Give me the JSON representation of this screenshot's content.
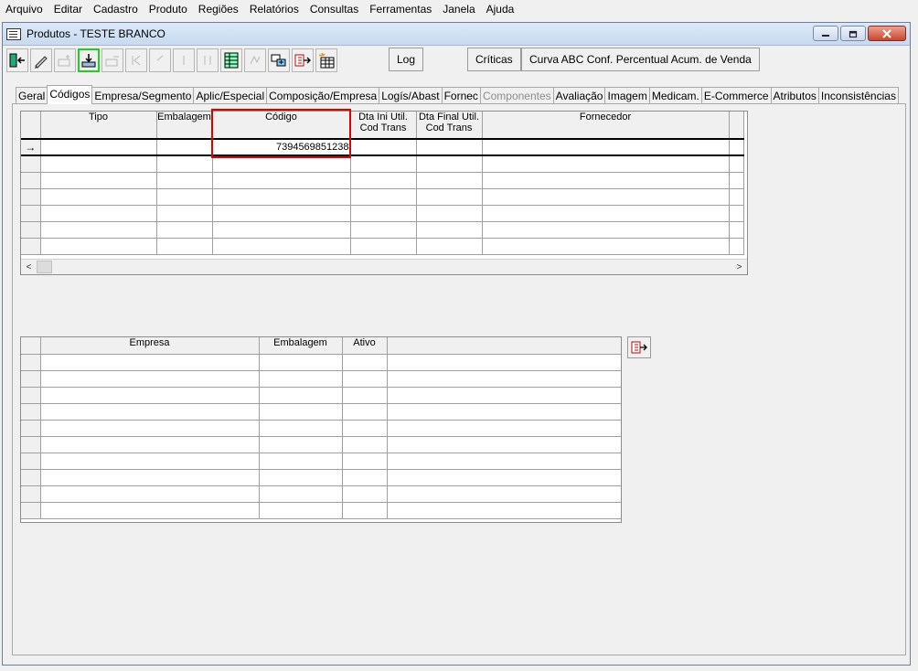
{
  "menu": [
    "Arquivo",
    "Editar",
    "Cadastro",
    "Produto",
    "Regiões",
    "Relatórios",
    "Consultas",
    "Ferramentas",
    "Janela",
    "Ajuda"
  ],
  "window": {
    "title": "Produtos - TESTE BRANCO"
  },
  "toolbar": {
    "log_label": "Log",
    "criticas_label": "Críticas",
    "curva_label": "Curva ABC Conf. Percentual Acum. de Venda"
  },
  "tabs": [
    "Geral",
    "Códigos",
    "Empresa/Segmento",
    "Aplic/Especial",
    "Composição/Empresa",
    "Logís/Abast",
    "Fornec",
    "Componentes",
    "Avaliação",
    "Imagem",
    "Medicam.",
    "E-Commerce",
    "Atributos",
    "Inconsistências"
  ],
  "active_tab": "Códigos",
  "codes_grid": {
    "headers": {
      "tipo": "Tipo",
      "embalagem": "Embalagem",
      "codigo": "Código",
      "dta_ini_1": "Dta Ini Util.",
      "dta_ini_2": "Cod Trans",
      "dta_fin_1": "Dta Final Util.",
      "dta_fin_2": "Cod Trans",
      "fornecedor": "Fornecedor"
    },
    "current_row": {
      "tipo": "",
      "embalagem": "",
      "codigo": "7394569851238",
      "indicator": "→"
    }
  },
  "empresa_grid": {
    "headers": {
      "empresa": "Empresa",
      "embalagem": "Embalagem",
      "ativo": "Ativo"
    }
  },
  "colors": {
    "selection_border": "#e00000",
    "active_tool_border": "#1fd01f"
  }
}
